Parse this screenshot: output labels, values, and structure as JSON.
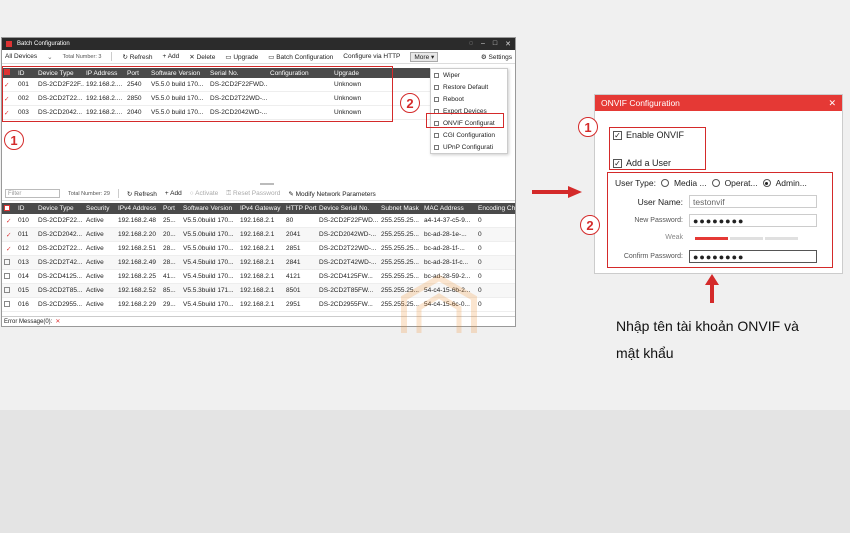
{
  "batch_window": {
    "title": "Batch Configuration",
    "toolbar": {
      "device_filter": "All Devices",
      "total_number": "Total Number: 3",
      "refresh": "Refresh",
      "add": "Add",
      "delete": "Delete",
      "upgrade": "Upgrade",
      "batch_configuration": "Batch Configuration",
      "configure_via_http": "Configure via HTTP",
      "more": "More",
      "settings": "Settings"
    },
    "top_grid": {
      "columns": [
        "ID",
        "Device Type",
        "IP Address",
        "Port",
        "Software Version",
        "Serial No.",
        "Configuration",
        "Upgrade"
      ],
      "rows": [
        [
          "001",
          "DS-2CD2F22F...",
          "192.168.2....",
          "2540",
          "V5.5.0 build 170...",
          "DS-2CD2F22FWD...",
          "",
          "Unknown"
        ],
        [
          "002",
          "DS-2CD2T22...",
          "192.168.2....",
          "2850",
          "V5.5.0 build 170...",
          "DS-2CD2T22WD-...",
          "",
          "Unknown"
        ],
        [
          "003",
          "DS-2CD2042...",
          "192.168.2....",
          "2040",
          "V5.5.0 build 170...",
          "DS-2CD2042WD-...",
          "",
          "Unknown"
        ]
      ]
    },
    "more_menu": [
      "Wiper",
      "Restore Default",
      "Reboot",
      "Export Devices",
      "ONVIF Configurat",
      "CGI Configuration",
      "UPnP Configurati"
    ],
    "lower_toolbar": {
      "filter_placeholder": "Filter",
      "total_number": "Total Number: 29",
      "refresh": "Refresh",
      "add": "Add",
      "activate": "Activate",
      "reset_password": "Reset Password",
      "modify_network": "Modify Network Parameters"
    },
    "bottom_grid": {
      "columns": [
        "ID",
        "Device Type",
        "Security",
        "IPv4 Address",
        "Port",
        "Software Version",
        "IPv4 Gateway",
        "HTTP Port",
        "Device Serial No.",
        "Subnet Mask",
        "MAC Address",
        "Encoding Ch"
      ],
      "rows": [
        [
          "010",
          "DS-2CD2F22...",
          "Active",
          "192.168.2.48",
          "25...",
          "V5.5.0build 170...",
          "192.168.2.1",
          "80",
          "DS-2CD2F22FWD...",
          "255.255.25...",
          "a4-14-37-c5-9...",
          "0"
        ],
        [
          "011",
          "DS-2CD2042...",
          "Active",
          "192.168.2.20",
          "20...",
          "V5.5.0build 170...",
          "192.168.2.1",
          "2041",
          "DS-2CD2042WD-...",
          "255.255.25...",
          "bc-ad-28-1e-...",
          "0"
        ],
        [
          "012",
          "DS-2CD2T22...",
          "Active",
          "192.168.2.51",
          "28...",
          "V5.5.0build 170...",
          "192.168.2.1",
          "2851",
          "DS-2CD2T22WD-...",
          "255.255.25...",
          "bc-ad-28-1f-...",
          "0"
        ],
        [
          "013",
          "DS-2CD2T42...",
          "Active",
          "192.168.2.49",
          "28...",
          "V5.4.5build 170...",
          "192.168.2.1",
          "2841",
          "DS-2CD2T42WD-...",
          "255.255.25...",
          "bc-ad-28-1f-c...",
          "0"
        ],
        [
          "014",
          "DS-2CD4125...",
          "Active",
          "192.168.2.25",
          "41...",
          "V5.4.5build 170...",
          "192.168.2.1",
          "4121",
          "DS-2CD4125FW...",
          "255.255.25...",
          "bc-ad-28-59-2...",
          "0"
        ],
        [
          "015",
          "DS-2CD2T85...",
          "Active",
          "192.168.2.52",
          "85...",
          "V5.5.3build 171...",
          "192.168.2.1",
          "8501",
          "DS-2CD2T85FW...",
          "255.255.25...",
          "54-c4-15-6b-2...",
          "0"
        ],
        [
          "016",
          "DS-2CD2955...",
          "Active",
          "192.168.2.29",
          "29...",
          "V5.4.5build 170...",
          "192.168.2.1",
          "2951",
          "DS-2CD2955FW...",
          "255.255.25...",
          "54-c4-15-6c-0...",
          "0"
        ]
      ]
    },
    "status_bar": "Error Message(0):"
  },
  "annotations": {
    "left_badge_1": "1",
    "left_badge_2": "2",
    "right_badge_1": "1",
    "right_badge_2": "2"
  },
  "onvif_dialog": {
    "title": "ONVIF Configuration",
    "enable_onvif": "Enable ONVIF",
    "add_user": "Add a User",
    "user_type_label": "User Type:",
    "user_types": [
      "Media ...",
      "Operat...",
      "Admin..."
    ],
    "selected_user_type": "Admin...",
    "user_name_label": "User Name:",
    "user_name_value": "testonvif",
    "new_password_label": "New Password:",
    "new_password_value": "●●●●●●●●",
    "strength_label": "Weak",
    "confirm_password_label": "Confirm Password:",
    "confirm_password_value": "●●●●●●●●"
  },
  "caption_line1": "Nhập tên tài khoản ONVIF và",
  "caption_line2": "mật khẩu",
  "colors": {
    "accent_red": "#e53935",
    "annotation_red": "#d42a2a"
  }
}
